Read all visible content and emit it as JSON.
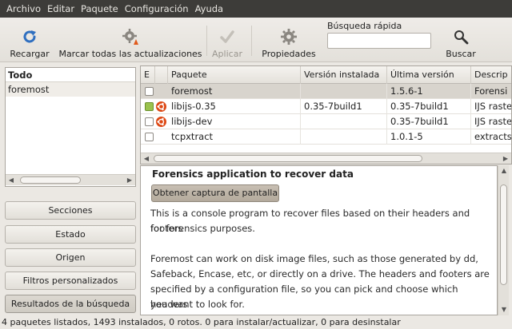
{
  "menubar": {
    "items": [
      "Archivo",
      "Editar",
      "Paquete",
      "Configuración",
      "Ayuda"
    ]
  },
  "toolbar": {
    "reload_label": "Recargar",
    "mark_all_label": "Marcar todas las actualizaciones",
    "apply_label": "Aplicar",
    "properties_label": "Propiedades",
    "quick_search_label": "Búsqueda rápida",
    "quick_search_value": "",
    "search_label": "Buscar"
  },
  "filters": {
    "header": "Todo",
    "items": [
      "foremost"
    ]
  },
  "side_buttons": {
    "sections": "Secciones",
    "status": "Estado",
    "origin": "Origen",
    "custom_filters": "Filtros personalizados",
    "search_results": "Resultados de la búsqueda"
  },
  "table": {
    "headers": [
      "E",
      "",
      "Paquete",
      "Versión instalada",
      "Última versión",
      "Descrip"
    ],
    "rows": [
      {
        "package": "foremost",
        "installed": "",
        "latest": "1.5.6-1",
        "description": "Forensi",
        "checked": false,
        "ubuntu": false
      },
      {
        "package": "libijs-0.35",
        "installed": "0.35-7build1",
        "latest": "0.35-7build1",
        "description": "IJS raste",
        "checked": true,
        "ubuntu": true
      },
      {
        "package": "libijs-dev",
        "installed": "",
        "latest": "0.35-7build1",
        "description": "IJS raste",
        "checked": false,
        "ubuntu": true
      },
      {
        "package": "tcpxtract",
        "installed": "",
        "latest": "1.0.1-5",
        "description": "extracts",
        "checked": false,
        "ubuntu": false
      }
    ]
  },
  "description": {
    "title": "Forensics application to recover data",
    "screenshot_button": "Obtener captura de pantalla",
    "paragraph1_line1": "This is a console program to recover files based on their headers and footers",
    "paragraph1_line2": "for forensics purposes.",
    "paragraph2_line1": "Foremost can work on disk image files, such as those generated by dd,",
    "paragraph2_line2": "Safeback, Encase, etc, or directly on a drive. The headers and footers are",
    "paragraph2_line3": "specified by a configuration file, so you can pick and choose which headers",
    "paragraph2_line4": "you want to look for."
  },
  "statusbar": {
    "text": "4 paquetes listados, 1493 instalados, 0 rotos. 0 para instalar/actualizar, 0 para desinstalar"
  },
  "colors": {
    "installed_checkbox": "#9ac24d",
    "ubuntu_logo": "#dd4814",
    "menubar_bg": "#3d3c39"
  }
}
